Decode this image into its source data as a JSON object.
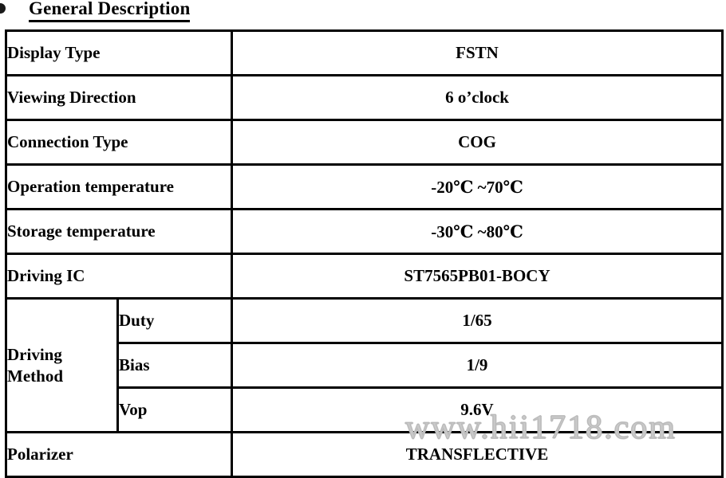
{
  "heading": {
    "bullet": "bullet-marker",
    "title": "General Description"
  },
  "table": {
    "rows": [
      {
        "label": "Display Type",
        "value": "FSTN"
      },
      {
        "label": "Viewing Direction",
        "value": "6 o’clock"
      },
      {
        "label": "Connection Type",
        "value": "COG"
      },
      {
        "label": "Operation temperature",
        "value": "-20℃ ~70℃"
      },
      {
        "label": "Storage temperature",
        "value": "-30℃ ~80℃"
      },
      {
        "label": "Driving IC",
        "value": "ST7565PB01-BOCY"
      }
    ],
    "driving_method": {
      "label": "Driving Method",
      "sub_rows": [
        {
          "label": "Duty",
          "value": "1/65"
        },
        {
          "label": "Bias",
          "value": "1/9"
        },
        {
          "label": "Vop",
          "value": "9.6V"
        }
      ]
    },
    "polarizer": {
      "label": "Polarizer",
      "value": "TRANSFLECTIVE"
    }
  },
  "watermark": {
    "text": "www.hii1718.com"
  },
  "colors": {
    "border": "#000000",
    "text": "#000000",
    "background": "#ffffff",
    "watermark": "#c9c9c9"
  }
}
